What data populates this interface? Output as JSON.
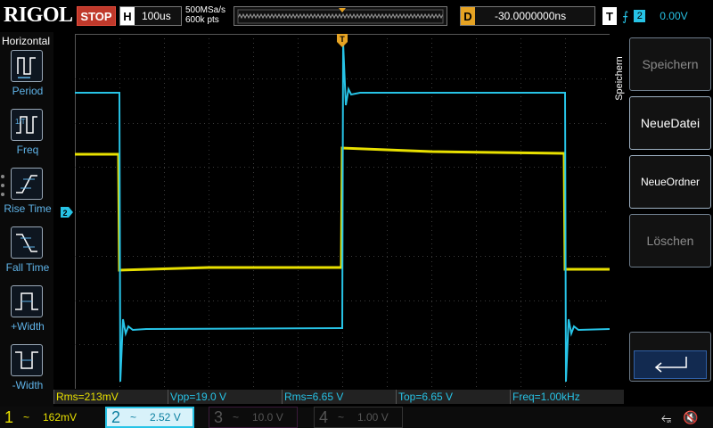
{
  "topbar": {
    "brand": "RIGOL",
    "run_state": "STOP",
    "timebase_key": "H",
    "timebase": "100us",
    "sample_rate": "500MSa/s",
    "memory_depth": "600k pts",
    "delay_key": "D",
    "delay": "-30.0000000ns",
    "trigger_key": "T",
    "trigger_edge_icon": "rising-edge-icon",
    "trigger_source": "2",
    "trigger_level": "0.00V"
  },
  "left_panel": {
    "title": "Horizontal",
    "items": [
      {
        "label": "Period",
        "icon": "period-icon"
      },
      {
        "label": "Freq",
        "icon": "freq-icon"
      },
      {
        "label": "Rise Time",
        "icon": "rise-time-icon"
      },
      {
        "label": "Fall Time",
        "icon": "fall-time-icon"
      },
      {
        "label": "+Width",
        "icon": "pos-width-icon"
      },
      {
        "label": "-Width",
        "icon": "neg-width-icon"
      }
    ]
  },
  "right_panel": {
    "title": "Speichern",
    "buttons": [
      {
        "label": "Speichern",
        "enabled": false
      },
      {
        "label": "NeueDatei",
        "enabled": true
      },
      {
        "label": "NeueOrdner",
        "enabled": true
      },
      {
        "label": "Löschen",
        "enabled": false
      }
    ],
    "enter_icon": "enter-icon"
  },
  "measurements": [
    {
      "label": "Rms=213mV",
      "channel": 1
    },
    {
      "label": "Vpp=19.0 V",
      "channel": 2
    },
    {
      "label": "Rms=6.65 V",
      "channel": 2
    },
    {
      "label": "Top=6.65 V",
      "channel": 2
    },
    {
      "label": "Freq=1.00kHz",
      "channel": 2
    }
  ],
  "channels": [
    {
      "num": "1",
      "coupling": "~",
      "scale": "162mV",
      "color": "#e8e000"
    },
    {
      "num": "2",
      "coupling": "~",
      "scale": "2.52 V",
      "color": "#27c3e6"
    },
    {
      "num": "3",
      "coupling": "~",
      "scale": "10.0 V",
      "color": "#c04bc0"
    },
    {
      "num": "4",
      "coupling": "~",
      "scale": "1.00 V",
      "color": "#3a6fd8"
    }
  ],
  "markers": {
    "trigger_position": "T",
    "ch2_offset": "2"
  },
  "colors": {
    "ch1": "#e8e000",
    "ch2": "#27c3e6",
    "trigger": "#e6a323",
    "stop": "#c0392b"
  },
  "status_icons": [
    "usb-icon",
    "speaker-muted-icon"
  ]
}
